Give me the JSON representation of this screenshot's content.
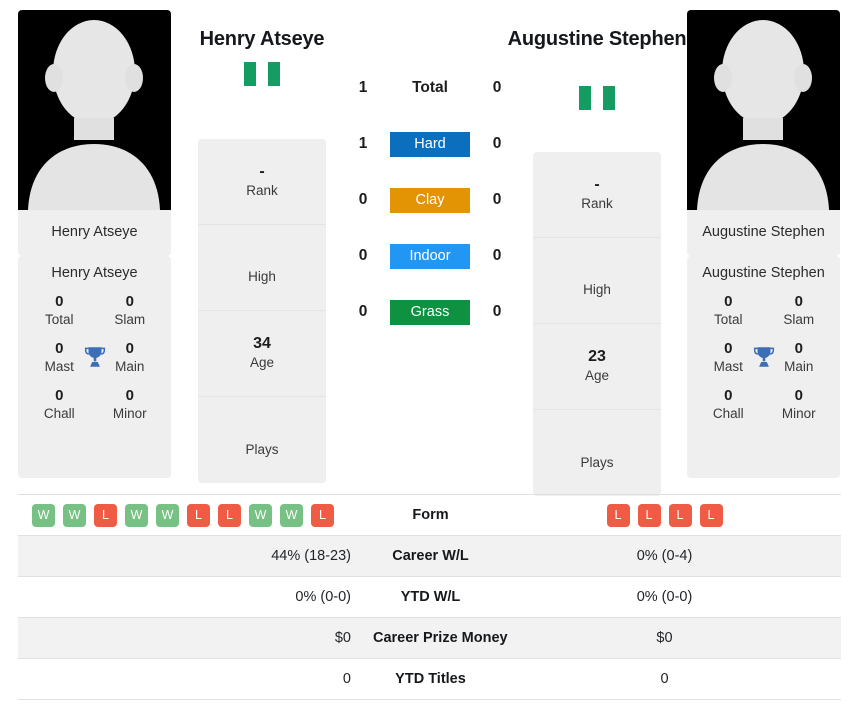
{
  "players": {
    "left": {
      "name": "Henry Atseye",
      "photo_caption": "Henry Atseye",
      "flag": "nigeria-flag",
      "rank": "-",
      "rank_label": "Rank",
      "high": "",
      "high_label": "High",
      "age": "34",
      "age_label": "Age",
      "plays": "",
      "plays_label": "Plays",
      "titles": {
        "total": "0",
        "total_label": "Total",
        "slam": "0",
        "slam_label": "Slam",
        "mast": "0",
        "mast_label": "Mast",
        "main": "0",
        "main_label": "Main",
        "chall": "0",
        "chall_label": "Chall",
        "minor": "0",
        "minor_label": "Minor"
      },
      "form": [
        "W",
        "W",
        "L",
        "W",
        "W",
        "L",
        "L",
        "W",
        "W",
        "L"
      ],
      "career_wl": "44% (18-23)",
      "ytd_wl": "0% (0-0)",
      "career_prize_money": "$0",
      "ytd_titles": "0"
    },
    "right": {
      "name": "Augustine Stephen",
      "photo_caption": "Augustine Stephen",
      "flag": "nigeria-flag",
      "rank": "-",
      "rank_label": "Rank",
      "high": "",
      "high_label": "High",
      "age": "23",
      "age_label": "Age",
      "plays": "",
      "plays_label": "Plays",
      "titles": {
        "total": "0",
        "total_label": "Total",
        "slam": "0",
        "slam_label": "Slam",
        "mast": "0",
        "mast_label": "Mast",
        "main": "0",
        "main_label": "Main",
        "chall": "0",
        "chall_label": "Chall",
        "minor": "0",
        "minor_label": "Minor"
      },
      "form": [
        "L",
        "L",
        "L",
        "L"
      ],
      "career_wl": "0% (0-4)",
      "ytd_wl": "0% (0-0)",
      "career_prize_money": "$0",
      "ytd_titles": "0"
    }
  },
  "head_to_head": {
    "rows": [
      {
        "label": "Total",
        "left": "1",
        "right": "0",
        "color": ""
      },
      {
        "label": "Hard",
        "left": "1",
        "right": "0",
        "color": "#0b6fbe"
      },
      {
        "label": "Clay",
        "left": "0",
        "right": "0",
        "color": "#e39405"
      },
      {
        "label": "Indoor",
        "left": "0",
        "right": "0",
        "color": "#2196f3"
      },
      {
        "label": "Grass",
        "left": "0",
        "right": "0",
        "color": "#0e9141"
      }
    ]
  },
  "table": {
    "rows": [
      {
        "label": "Form",
        "left": "",
        "right": ""
      },
      {
        "label": "Career W/L",
        "left": "44% (18-23)",
        "right": "0% (0-4)"
      },
      {
        "label": "YTD W/L",
        "left": "0% (0-0)",
        "right": "0% (0-0)"
      },
      {
        "label": "Career Prize Money",
        "left": "$0",
        "right": "$0"
      },
      {
        "label": "YTD Titles",
        "left": "0",
        "right": "0"
      }
    ]
  },
  "colors": {
    "hard": "#0b6fbe",
    "clay": "#e39405",
    "indoor": "#2196f3",
    "grass": "#0e9141",
    "win_badge": "#76c183",
    "loss_badge": "#ef5b45",
    "trophy": "#3b6eb5",
    "flag_green": "#169b62"
  }
}
